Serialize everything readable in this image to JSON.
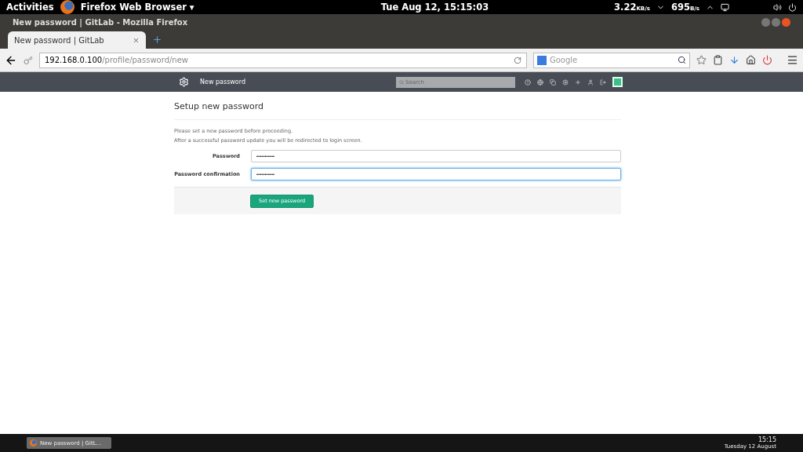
{
  "top_bar": {
    "activities": "Activities",
    "app_menu": "Firefox Web Browser ▾",
    "clock": "Tue Aug 12, 15:15:03",
    "down_speed": "3.22",
    "down_unit": "KB/s",
    "up_speed": "695",
    "up_unit": "B/s"
  },
  "window": {
    "title": "New password | GitLab - Mozilla Firefox"
  },
  "tabs": [
    {
      "label": "New password | GitLab",
      "selected": true
    }
  ],
  "nav": {
    "url_host": "192.168.0.100",
    "url_path": "/profile/password/new",
    "search_placeholder": "Google"
  },
  "gitlab_header": {
    "title": "New password",
    "search_placeholder": "Search"
  },
  "page": {
    "heading": "Setup new password",
    "notes": [
      "Please set a new password before proceeding.",
      "After a successful password update you will be redirected to login screen."
    ],
    "fields": [
      {
        "label": "Password",
        "value": "•••••••••••",
        "focused": false
      },
      {
        "label": "Password confirmation",
        "value": "•••••••••••",
        "focused": true
      }
    ],
    "submit": "Set new password"
  },
  "taskbar": {
    "items": [
      {
        "label": "New password | GitL...",
        "selected": true
      }
    ],
    "time": "15:15",
    "date": "Tuesday 12 August"
  }
}
